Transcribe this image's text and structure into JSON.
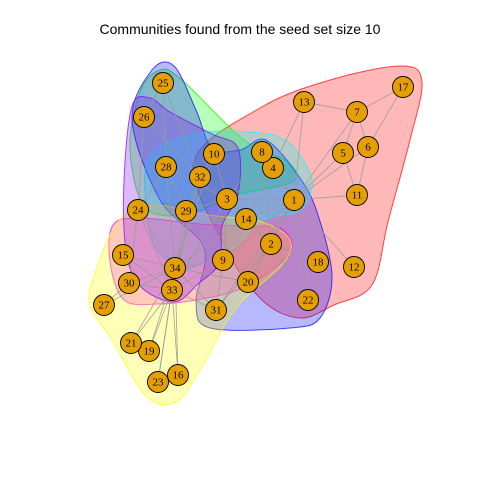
{
  "title": "Communities found from the seed set size 10",
  "colors": {
    "node_fill": "#E69F00",
    "edge": "#9a9a9a",
    "community_red": "#FF0000",
    "community_green": "#00FF00",
    "community_blue": "#0000FF",
    "community_cyan": "#00FFFF",
    "community_magenta": "#FF00FF",
    "community_yellow": "#FFFF00",
    "community_purple": "#8000FF"
  },
  "nodes": [
    "1",
    "2",
    "3",
    "4",
    "5",
    "6",
    "7",
    "8",
    "9",
    "10",
    "11",
    "12",
    "13",
    "14",
    "15",
    "16",
    "17",
    "18",
    "19",
    "20",
    "21",
    "22",
    "23",
    "24",
    "25",
    "26",
    "27",
    "28",
    "29",
    "30",
    "31",
    "32",
    "33",
    "34"
  ],
  "communities": [
    "red",
    "green",
    "blue",
    "cyan",
    "magenta",
    "yellow",
    "purple"
  ]
}
